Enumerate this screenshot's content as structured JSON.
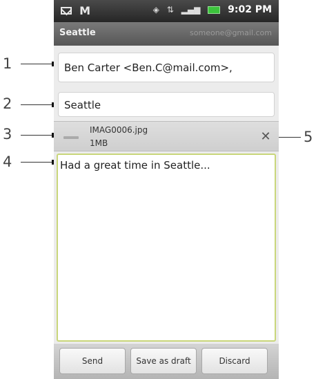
{
  "callouts": [
    "1",
    "2",
    "3",
    "4",
    "5"
  ],
  "status_bar": {
    "left_icons": [
      "mail-icon",
      "gmail-icon"
    ],
    "time": "9:02 PM"
  },
  "title_bar": {
    "title": "Seattle",
    "account": "someone@gmail.com"
  },
  "to_field": {
    "value": "Ben Carter <Ben.C@mail.com>,"
  },
  "subject_field": {
    "value": "Seattle"
  },
  "attachment": {
    "filename": "IMAG0006.jpg",
    "size": "1MB"
  },
  "body_field": {
    "value": "Had a great time in Seattle..."
  },
  "actions": {
    "send": "Send",
    "save_draft": "Save as draft",
    "discard": "Discard"
  },
  "colors": {
    "focus_border": "#c9d67a",
    "status_bar": "#2e2e2e",
    "title_bar": "#666666"
  }
}
